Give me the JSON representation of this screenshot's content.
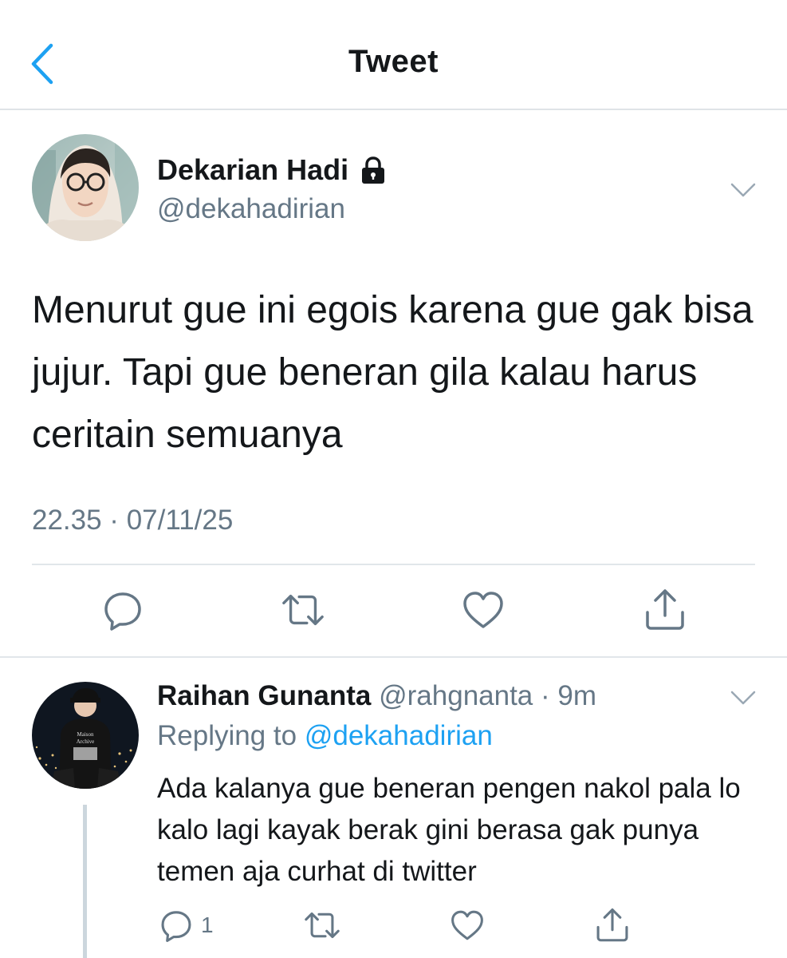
{
  "header": {
    "title": "Tweet",
    "back_icon": "chevron-left-icon",
    "accent_color": "#1da1f2"
  },
  "tweet": {
    "author_name": "Dekarian Hadi",
    "author_handle": "@dekahadirian",
    "locked_icon": "lock-icon",
    "text": "Menurut gue ini egois karena gue gak bisa jujur. Tapi gue beneran gila kalau harus ceritain semuanya",
    "timestamp": "22.35 · 07/11/25",
    "actions": [
      "reply-icon",
      "retweet-icon",
      "like-icon",
      "share-icon"
    ]
  },
  "reply": {
    "author_name": "Raihan Gunanta",
    "author_handle": "@rahgnanta",
    "time": "· 9m",
    "replying_prefix": "Replying to",
    "replying_handle": "@dekahadirian",
    "text": "Ada kalanya gue beneran pengen nakol pala lo kalo lagi kayak berak gini berasa gak punya temen aja curhat di twitter",
    "reply_count": "1",
    "actions": [
      "reply-icon",
      "retweet-icon",
      "like-icon",
      "share-icon"
    ]
  },
  "colors": {
    "text_primary": "#14171a",
    "text_secondary": "#657786",
    "link": "#1da1f2",
    "divider": "#e1e6ea"
  }
}
